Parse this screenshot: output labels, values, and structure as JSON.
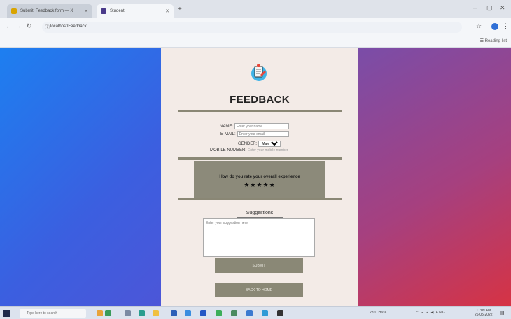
{
  "browser": {
    "tabs": [
      {
        "title": "Submit, Feedback form — X",
        "active": false,
        "color": "#d9a400"
      },
      {
        "title": "Student",
        "active": true,
        "color": "#4a3a8a"
      }
    ],
    "new_tab_icon": "plus-icon",
    "window_controls": [
      "minimize-icon",
      "maximize-icon",
      "close-icon"
    ],
    "address": "localhost/Feedback",
    "reading_list": "Reading list"
  },
  "page": {
    "heading": "FEEDBACK",
    "fields": {
      "name_label": "NAME:",
      "name_placeholder": "Enter your name",
      "email_label": "E-MAIL:",
      "email_placeholder": "Enter your email",
      "gender_label": "GENDER:",
      "gender_value": "Male",
      "mobile_label": "MOBILE NUMBER:",
      "mobile_placeholder": "Enter your mobile number"
    },
    "rating": {
      "question": "How do you rate your overall experience",
      "stars": "★★★★★",
      "value": 5,
      "max": 5
    },
    "suggestions": {
      "label": "Suggestions",
      "placeholder": "Enter your suggestion here"
    },
    "submit_label": "SUBMIT",
    "back_label": "BACK TO HOME"
  },
  "colors": {
    "left_gradient": [
      "#1d7ff0",
      "#4c56d8"
    ],
    "right_gradient": [
      "#7a4da8",
      "#d63344"
    ],
    "card": "#f3ebe7",
    "accent": "#8a8876"
  },
  "taskbar": {
    "search_placeholder": "Type here to search",
    "weather": "28°C Haze",
    "time": "11:09 AM",
    "date": "26-05-2022"
  }
}
